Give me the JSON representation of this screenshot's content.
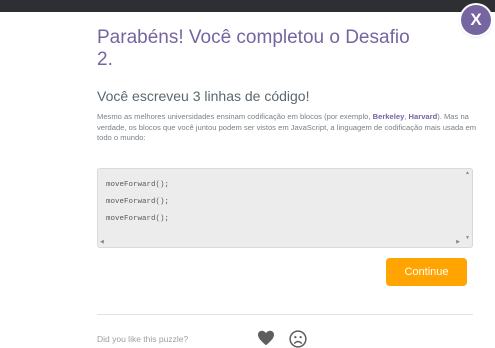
{
  "dialog": {
    "close_label": "X",
    "title": "Parabéns! Você completou o Desafio 2.",
    "subtitle": "Você escreveu 3 linhas de código!",
    "desc_before": "Mesmo as melhores universidades ensinam codificação em blocos (por exemplo, ",
    "link_berkeley": "Berkeley",
    "desc_sep": ", ",
    "link_harvard": "Harvard",
    "desc_after": "). Mas na verdade, os blocos que você juntou podem ser vistos em JavaScript, a linguagem de codificação mais usada em todo o mundo:",
    "code_lines": [
      "moveForward();",
      "moveForward();",
      "moveForward();"
    ],
    "continue_label": "Continue",
    "feedback_prompt": "Did you like this puzzle?",
    "icons": {
      "like": "heart-icon",
      "dislike": "sad-face-icon",
      "close": "close-icon"
    }
  },
  "colors": {
    "accent_purple": "#7665a0",
    "continue_orange": "#ffa400",
    "top_bar": "#2d2f33"
  }
}
